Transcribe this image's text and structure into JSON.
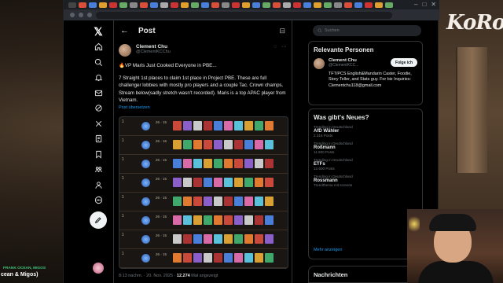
{
  "stream": {
    "channel_logo": "KoRo",
    "chat_user": "FRANK OCEAN, MIGOS",
    "chat_text": "cean & Migos)"
  },
  "nav": {
    "items": [
      "x-logo-icon",
      "home-icon",
      "search-icon",
      "notifications-icon",
      "messages-icon",
      "grok-icon",
      "x-premium-icon",
      "lists-icon",
      "bookmarks-icon",
      "communities-icon",
      "profile-icon",
      "more-icon"
    ]
  },
  "post": {
    "header_title": "Post",
    "author_name": "Clement Chu",
    "author_handle": "@ClementKCChu",
    "title_line": "🔥VP Maris Just Cooked Everyone in PBE...",
    "body": "7 Straight 1st places to claim 1st place in Project PBE. These are full challenger lobbies with mostly pro players and a couple Tac. Crown champs. Stream below(sadly stretch wasn't recorded). Maris is a top APAC player from Vietnam.",
    "translate": "Post übersetzen",
    "footer_time": "8:13 nachm. · 20. Nov. 2025 ·",
    "footer_views": "12.274",
    "footer_views_label": "Mal angezeigt"
  },
  "lobby_rows": [
    {
      "place": "1",
      "stats": "26 · 15"
    },
    {
      "place": "1",
      "stats": "26 · 16"
    },
    {
      "place": "1",
      "stats": "26 · 15"
    },
    {
      "place": "1",
      "stats": "26 · 15"
    },
    {
      "place": "1",
      "stats": "26 · 15"
    },
    {
      "place": "1",
      "stats": "26 · 15"
    },
    {
      "place": "1",
      "stats": "26 · 15"
    },
    {
      "place": "1",
      "stats": "26 · 15"
    }
  ],
  "sidebar": {
    "search_placeholder": "Suchen",
    "persons_title": "Relevante Personen",
    "person_name": "Clement Chu",
    "person_handle": "@ClementKCC...",
    "follow_label": "Folge ich",
    "person_bio": "TFT/PCS English&Mandarin Caster, Foodie, Story Teller, and Stats guy. For biz Inquiries: Clementchu118@gmail.com",
    "news_title": "Was gibt's Neues?",
    "trends": [
      {
        "ctx": "Trending in Deutschland",
        "name": "AfD Wähler",
        "count": "2.316 Posts"
      },
      {
        "ctx": "Trending in Deutschland",
        "name": "Roßmann",
        "count": "11.900 Posts"
      },
      {
        "ctx": "Trending in Deutschland",
        "name": "ETFs",
        "count": "12.600 Posts"
      },
      {
        "ctx": "Trending in Deutschland",
        "name": "Rossmann",
        "count": "Trendthema mit screens"
      }
    ],
    "show_more": "Mehr anzeigen",
    "messages_title": "Nachrichten"
  }
}
